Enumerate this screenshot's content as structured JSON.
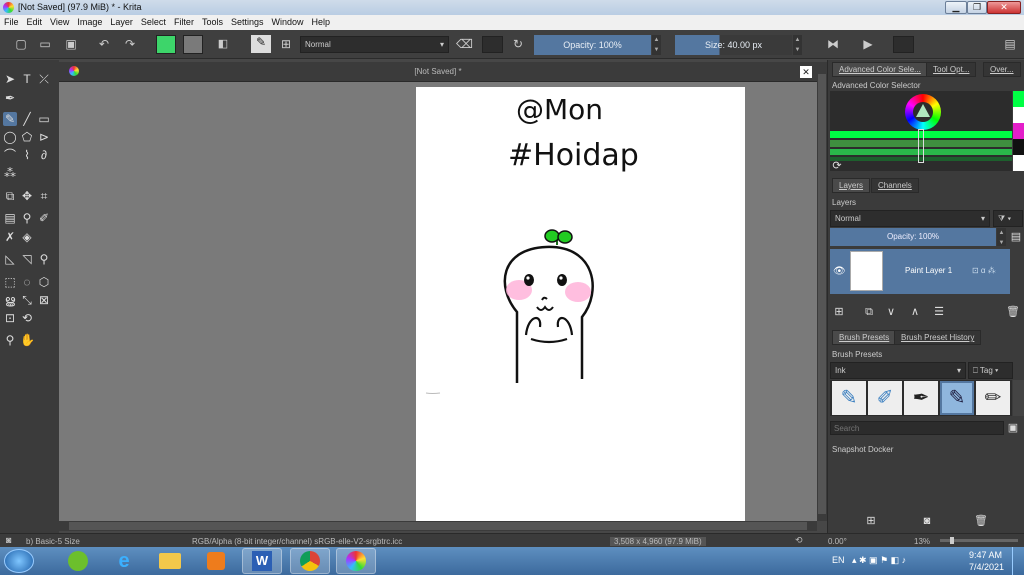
{
  "window": {
    "title": "[Not Saved]  (97.9 MiB)  * - Krita"
  },
  "menu": [
    "File",
    "Edit",
    "View",
    "Image",
    "Layer",
    "Select",
    "Filter",
    "Tools",
    "Settings",
    "Window",
    "Help"
  ],
  "toolbar": {
    "blend_mode": "Normal",
    "opacity": "Opacity: 100%",
    "size": "Size: 40.00 px",
    "fg_color": "#3dd56a",
    "bg_color": "#7a7a7a"
  },
  "document": {
    "tab_title": "[Not Saved]  *"
  },
  "canvas": {
    "line1": "@Mon",
    "line2": "#Hoidap"
  },
  "dock": {
    "top_tabs": [
      "Advanced Color Sele...",
      "Tool Opt...",
      "Over..."
    ],
    "color_selector_title": "Advanced Color Selector",
    "layer_tabs": [
      "Layers",
      "Channels"
    ],
    "layers_title": "Layers",
    "layer_blend": "Normal",
    "layer_opacity": "Opacity:  100%",
    "layer_name": "Paint Layer 1",
    "brush_tabs": [
      "Brush Presets",
      "Brush Preset History"
    ],
    "brush_presets_title": "Brush Presets",
    "brush_tag": "Ink",
    "tag_label": "Tag",
    "search_placeholder": "Search",
    "snapshot_title": "Snapshot Docker"
  },
  "status": {
    "brush": "b) Basic-5 Size",
    "color_space": "RGB/Alpha (8-bit integer/channel)  sRGB-elle-V2-srgbtrc.icc",
    "dimensions": "3,508 x 4,960 (97.9 MiB)",
    "rotation": "0.00°",
    "zoom": "13%"
  },
  "taskbar": {
    "lang": "EN",
    "time": "9:47 AM",
    "date": "7/4/2021"
  }
}
